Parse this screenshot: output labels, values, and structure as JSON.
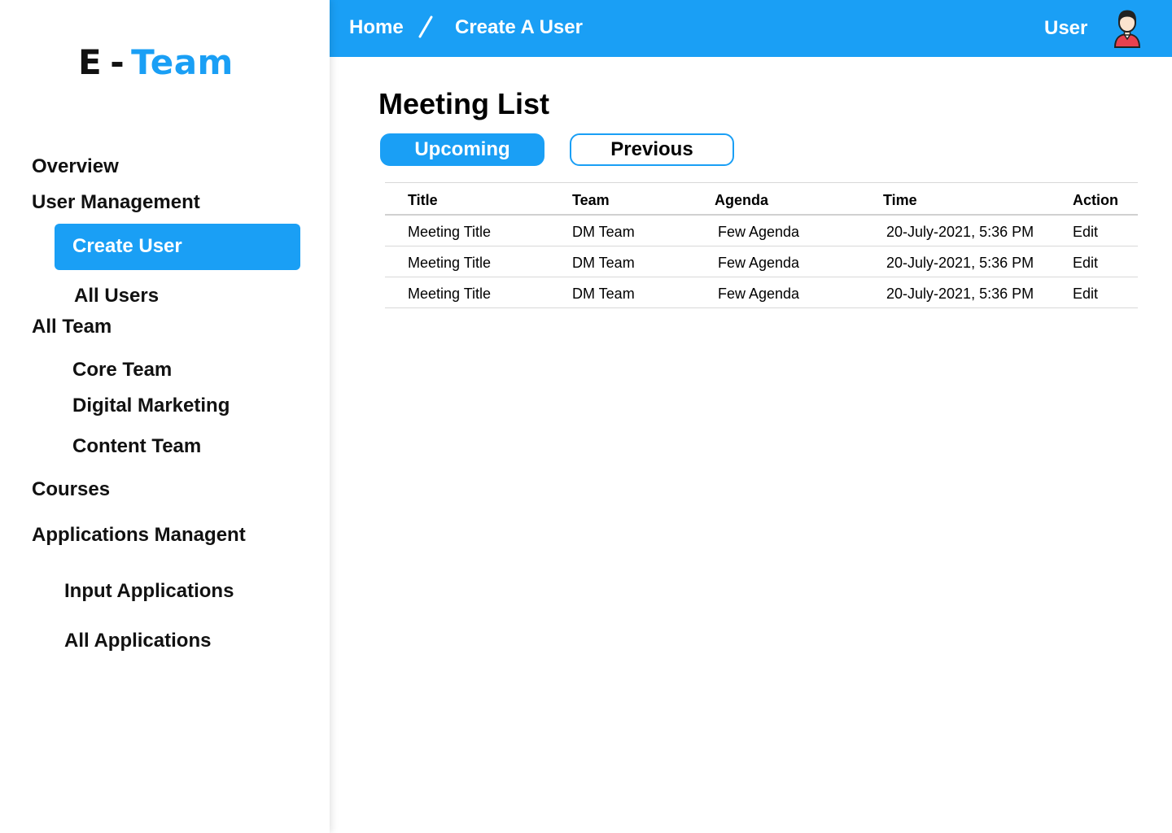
{
  "brand": {
    "prefix": "E",
    "dash": "-",
    "name": "Team",
    "accent_color": "#1a9ff5"
  },
  "sidebar": {
    "overview": "Overview",
    "user_management": "User Management",
    "create_user": "Create User",
    "all_users": "All Users",
    "all_team": "All Team",
    "core_team": "Core Team",
    "digital_marketing": "Digital Marketing",
    "content_team": "Content Team",
    "courses": "Courses",
    "applications_managent": "Applications Managent",
    "input_applications": "Input Applications",
    "all_applications": "All Applications"
  },
  "topbar": {
    "home": "Home",
    "separator": "/",
    "current": "Create A User",
    "user_label": "User",
    "avatar_icon": "user-avatar-icon"
  },
  "main": {
    "title": "Meeting List",
    "tabs": {
      "upcoming": "Upcoming",
      "previous": "Previous",
      "selected": "Upcoming"
    },
    "table": {
      "headers": {
        "title": "Title",
        "team": "Team",
        "agenda": "Agenda",
        "time": "Time",
        "action": "Action"
      },
      "rows": [
        {
          "title": "Meeting Title",
          "team": "DM Team",
          "agenda": "Few Agenda",
          "time": "20-July-2021, 5:36 PM",
          "action": "Edit"
        },
        {
          "title": "Meeting Title",
          "team": "DM Team",
          "agenda": "Few Agenda",
          "time": "20-July-2021, 5:36 PM",
          "action": "Edit"
        },
        {
          "title": "Meeting Title",
          "team": "DM Team",
          "agenda": "Few Agenda",
          "time": "20-July-2021, 5:36 PM",
          "action": "Edit"
        }
      ]
    }
  }
}
